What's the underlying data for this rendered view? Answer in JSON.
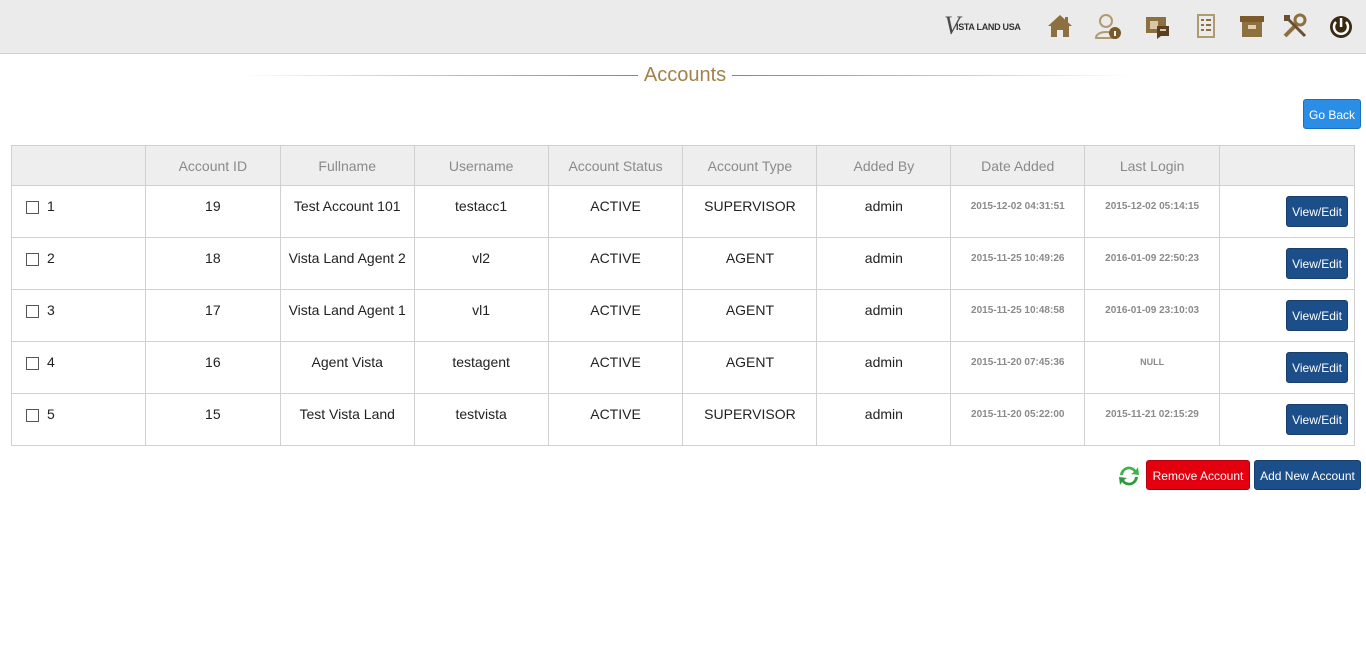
{
  "brand": {
    "logo_letter": "V",
    "logo_text": "ISTA LAND USA"
  },
  "nav_icons": [
    "home-icon",
    "user-info-icon",
    "id-card-icon",
    "list-icon",
    "archive-icon",
    "tools-icon",
    "power-icon"
  ],
  "page": {
    "title": "Accounts",
    "go_back_label": "Go Back"
  },
  "table": {
    "headers": [
      "",
      "Account ID",
      "Fullname",
      "Username",
      "Account Status",
      "Account Type",
      "Added By",
      "Date Added",
      "Last Login",
      ""
    ],
    "rows": [
      {
        "num": "1",
        "account_id": "19",
        "fullname": "Test Account 101",
        "username": "testacc1",
        "status": "ACTIVE",
        "type": "SUPERVISOR",
        "added_by": "admin",
        "date_added": "2015-12-02 04:31:51",
        "last_login": "2015-12-02 05:14:15",
        "action": "View/Edit"
      },
      {
        "num": "2",
        "account_id": "18",
        "fullname": "Vista Land Agent 2",
        "username": "vl2",
        "status": "ACTIVE",
        "type": "AGENT",
        "added_by": "admin",
        "date_added": "2015-11-25 10:49:26",
        "last_login": "2016-01-09 22:50:23",
        "action": "View/Edit"
      },
      {
        "num": "3",
        "account_id": "17",
        "fullname": "Vista Land Agent 1",
        "username": "vl1",
        "status": "ACTIVE",
        "type": "AGENT",
        "added_by": "admin",
        "date_added": "2015-11-25 10:48:58",
        "last_login": "2016-01-09 23:10:03",
        "action": "View/Edit"
      },
      {
        "num": "4",
        "account_id": "16",
        "fullname": "Agent Vista",
        "username": "testagent",
        "status": "ACTIVE",
        "type": "AGENT",
        "added_by": "admin",
        "date_added": "2015-11-20 07:45:36",
        "last_login": "NULL",
        "action": "View/Edit"
      },
      {
        "num": "5",
        "account_id": "15",
        "fullname": "Test Vista Land",
        "username": "testvista",
        "status": "ACTIVE",
        "type": "SUPERVISOR",
        "added_by": "admin",
        "date_added": "2015-11-20 05:22:00",
        "last_login": "2015-11-21 02:15:29",
        "action": "View/Edit"
      }
    ]
  },
  "footer": {
    "remove_label": "Remove Account",
    "add_label": "Add New Account",
    "refresh_icon": "refresh-icon"
  },
  "colors": {
    "accent_gold": "#a0824a",
    "primary_blue": "#1c4f8a",
    "go_back_blue": "#2b8ee6",
    "danger_red": "#e3000f"
  }
}
